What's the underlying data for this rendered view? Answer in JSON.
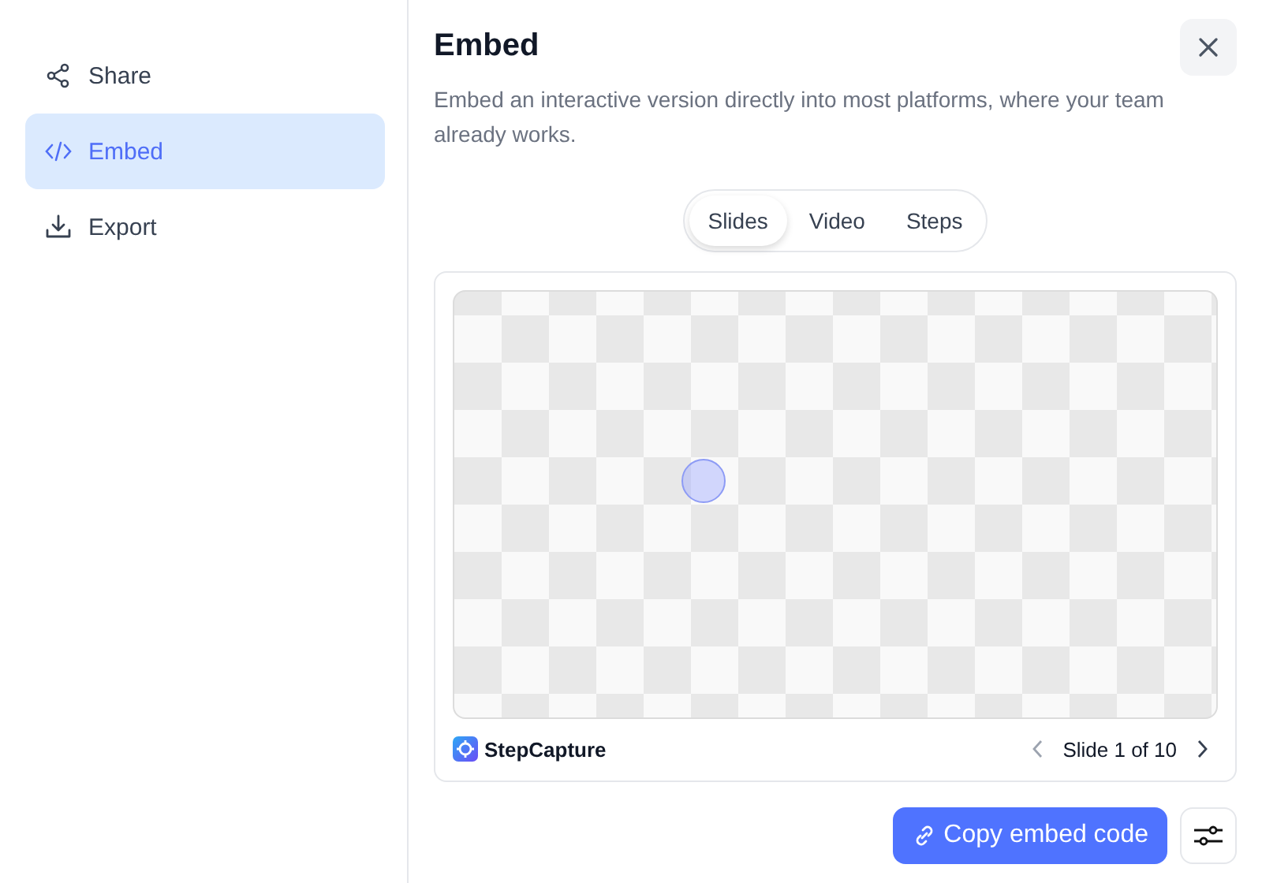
{
  "sidebar": {
    "items": [
      {
        "label": "Share",
        "selected": false
      },
      {
        "label": "Embed",
        "selected": true
      },
      {
        "label": "Export",
        "selected": false
      }
    ]
  },
  "panel": {
    "title": "Embed",
    "description": "Embed an interactive version directly into most platforms, where your team already works.",
    "tabs": [
      {
        "label": "Slides",
        "selected": true
      },
      {
        "label": "Video",
        "selected": false
      },
      {
        "label": "Steps",
        "selected": false
      }
    ],
    "preview": {
      "brand": "StepCapture",
      "pager": "Slide 1 of 10"
    },
    "primary_button": "Copy embed code"
  }
}
